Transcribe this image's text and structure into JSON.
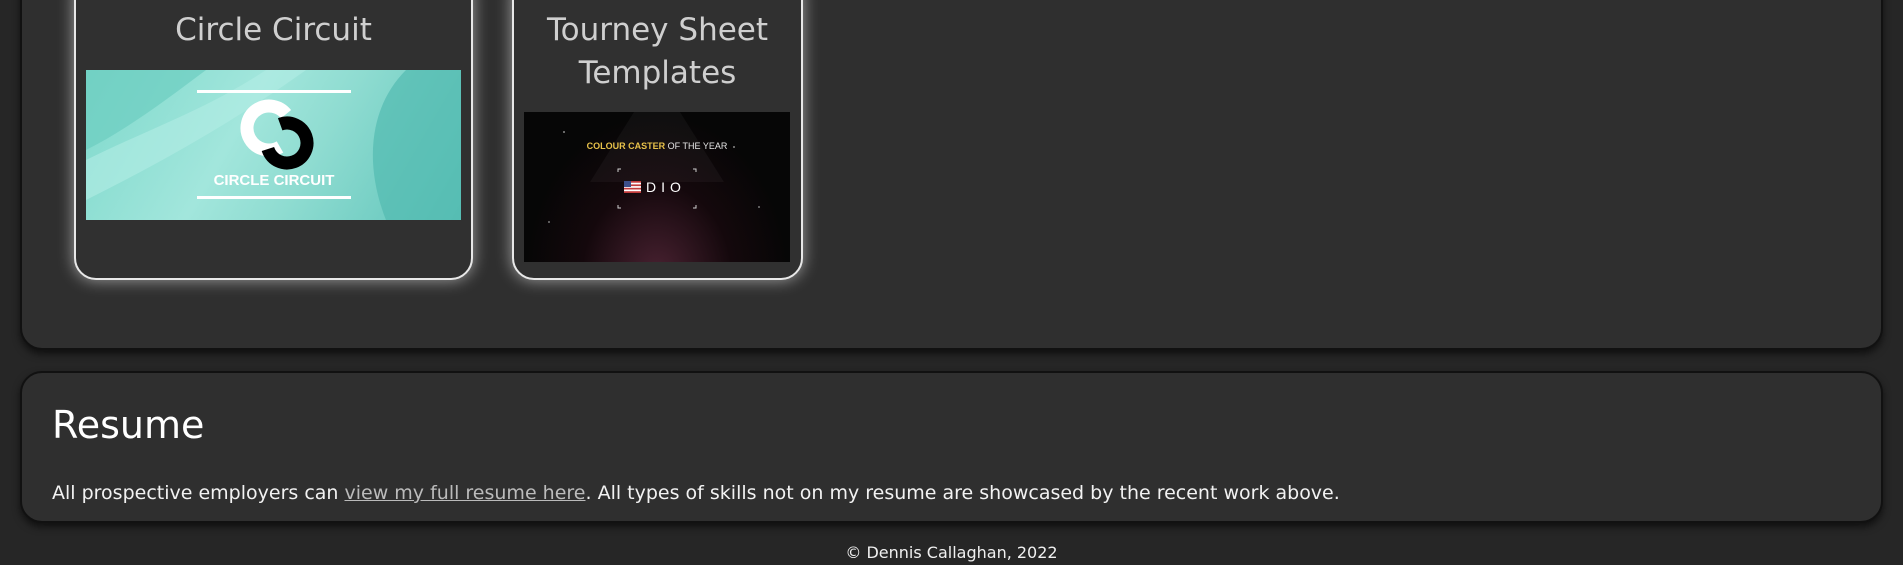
{
  "projects": [
    {
      "title": "Circle Circuit",
      "thumbnail": {
        "text": "CIRCLE CIRCUIT",
        "icon": "circle-circuit-logo-icon",
        "colors": {
          "bg": "#8fdcd1",
          "accent": "#000000"
        }
      }
    },
    {
      "title": "Tourney Sheet Templates",
      "thumbnail": {
        "headline_highlight": "COLOUR CASTER",
        "headline_rest": " OF THE YEAR",
        "player": "DIO",
        "icon": "us-flag-icon",
        "colors": {
          "highlight": "#e8c24a"
        }
      }
    }
  ],
  "resume": {
    "title": "Resume",
    "text_before": "All prospective employers can ",
    "link_text": "view my full resume here",
    "text_after": ". All types of skills not on my resume are showcased by the recent work above."
  },
  "footer": {
    "text": "© Dennis Callaghan, 2022"
  },
  "colors": {
    "page_bg": "#262626",
    "panel_bg": "#2f2f2f",
    "card_border": "#e8e8e8",
    "link": "#bbbbbb"
  }
}
